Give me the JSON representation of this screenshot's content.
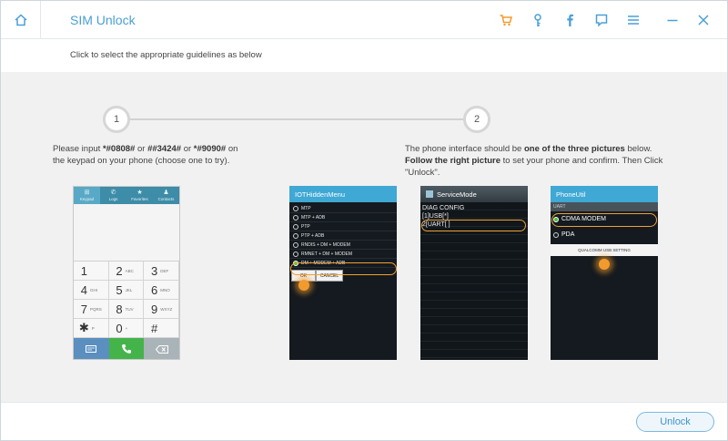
{
  "window": {
    "title": "SIM Unlock"
  },
  "titlebar_icons": [
    "cart-icon",
    "key-icon",
    "facebook-icon",
    "chat-icon",
    "menu-icon",
    "minimize-icon",
    "close-icon"
  ],
  "colors": {
    "accent": "#4a9fd8",
    "cart": "#f29a2e",
    "highlight": "#f0a030"
  },
  "instruction": "Click to select the appropriate guidelines as below",
  "steps": [
    {
      "number": "1"
    },
    {
      "number": "2"
    }
  ],
  "step1": {
    "t1": "Please input ",
    "c1": "*#0808#",
    "t2": " or ",
    "c2": "##3424#",
    "t3": " or ",
    "c3": "*#9090#",
    "t4": " on",
    "line2": "the keypad on your phone (choose one to try)."
  },
  "step2": {
    "t1": "The phone interface should be ",
    "b1": "one of the three pictures",
    "t2": " below.",
    "b2": "Follow the right picture",
    "t3": " to set your phone and confirm. Then Click",
    "line3": "\"Unlock\"."
  },
  "keypad": {
    "tabs": [
      {
        "glyph": "⊞",
        "label": "Keypad"
      },
      {
        "glyph": "✆",
        "label": "Logs"
      },
      {
        "glyph": "★",
        "label": "Favorites"
      },
      {
        "glyph": "♟",
        "label": "Contacts"
      }
    ],
    "keys": [
      {
        "digit": "1",
        "letters": ""
      },
      {
        "digit": "2",
        "letters": "ABC"
      },
      {
        "digit": "3",
        "letters": "DEF"
      },
      {
        "digit": "4",
        "letters": "GHI"
      },
      {
        "digit": "5",
        "letters": "JKL"
      },
      {
        "digit": "6",
        "letters": "MNO"
      },
      {
        "digit": "7",
        "letters": "PQRS"
      },
      {
        "digit": "8",
        "letters": "TUV"
      },
      {
        "digit": "9",
        "letters": "WXYZ"
      },
      {
        "digit": "✱",
        "letters": "P"
      },
      {
        "digit": "0",
        "letters": "+"
      },
      {
        "digit": "#",
        "letters": ""
      }
    ]
  },
  "screen1": {
    "title": "IOTHiddenMenu",
    "options": [
      "MTP",
      "MTP + ADB",
      "PTP",
      "PTP + ADB",
      "RNDIS + DM + MODEM",
      "RMNET + DM + MODEM",
      "DM + MODEM + ADB"
    ],
    "ok": "OK",
    "cancel": "CANCEL"
  },
  "screen2": {
    "title": "ServiceMode",
    "lines": [
      "DIAG CONFIG",
      "[1]USB[*]",
      "2[UART[ ]"
    ]
  },
  "screen3": {
    "title": "PhoneUtil",
    "section": "UART",
    "options": [
      "CDMA MODEM",
      "PDA"
    ],
    "button": "QUALCOMM USB SETTING"
  },
  "footer": {
    "unlock_label": "Unlock"
  }
}
